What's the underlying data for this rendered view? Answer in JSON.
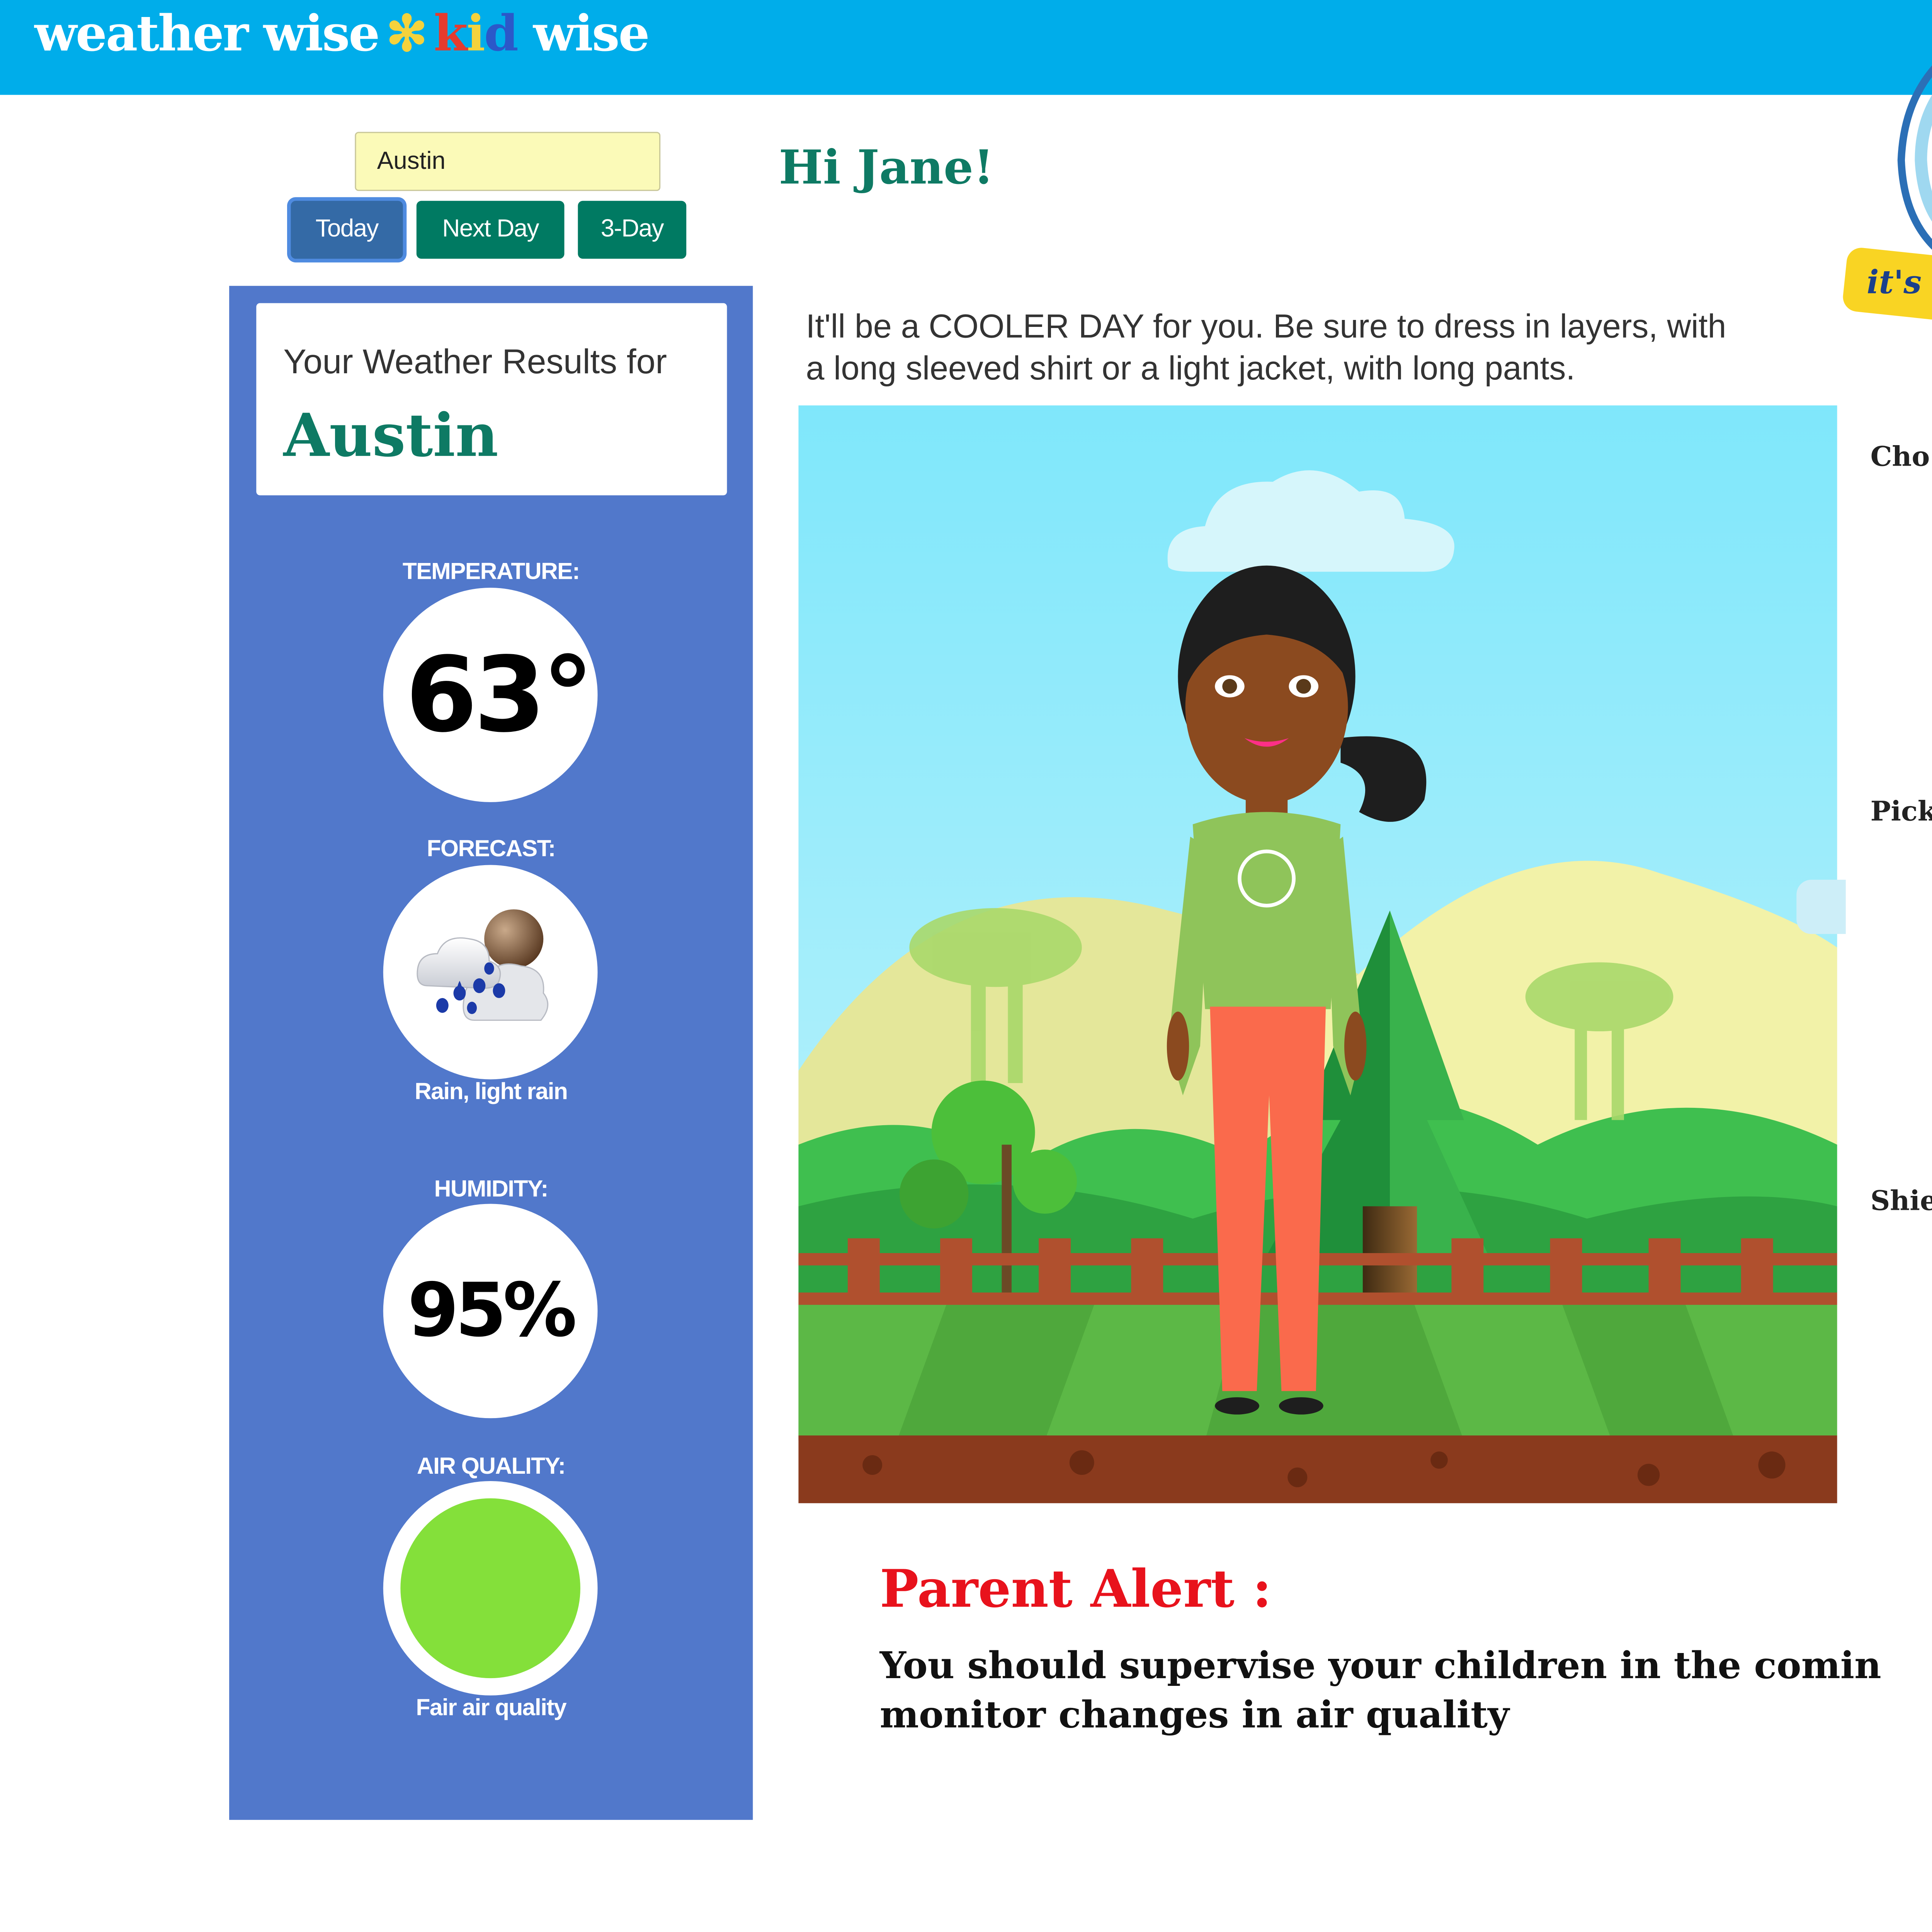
{
  "header": {
    "logo": {
      "part1": "weather wise",
      "star": "✻",
      "kid_k": "k",
      "kid_i": "i",
      "kid_d": "d",
      "part2": "wise"
    },
    "colors": {
      "bar": "#00adea",
      "kid_k": "#e63b2e",
      "kid_i": "#f4d23c",
      "kid_d": "#2b58c9"
    }
  },
  "search": {
    "value": "Austin"
  },
  "tabs": {
    "today": "Today",
    "next_day": "Next Day",
    "three_day": "3-Day"
  },
  "results": {
    "label": "Your Weather Results for",
    "city": "Austin",
    "temperature": {
      "label": "TEMPERATURE:",
      "value": "63°"
    },
    "forecast": {
      "label": "FORECAST:",
      "icon": "rain-cloud-icon",
      "description": "Rain, light rain"
    },
    "humidity": {
      "label": "HUMIDITY:",
      "value": "95%"
    },
    "air_quality": {
      "label": "AIR QUALITY:",
      "description": "Fair air quality",
      "color": "#84e03a"
    }
  },
  "main": {
    "greeting": "Hi Jane!",
    "advice": "It'll be a COOLER DAY for you. Be sure to dress in layers, with a long sleeved shirt or a light jacket, with long pants.",
    "scene_icon": "girl-avatar-outdoor-scene",
    "shirt_logo_icon": "bicycle-icon"
  },
  "alert": {
    "title": "Parent Alert :",
    "line1": "You should supervise your children in the comin",
    "line2": "monitor changes in air quality"
  },
  "sidebar_right": {
    "badge": "it's",
    "labels": [
      "Cho",
      "Pick",
      "Shie"
    ]
  }
}
